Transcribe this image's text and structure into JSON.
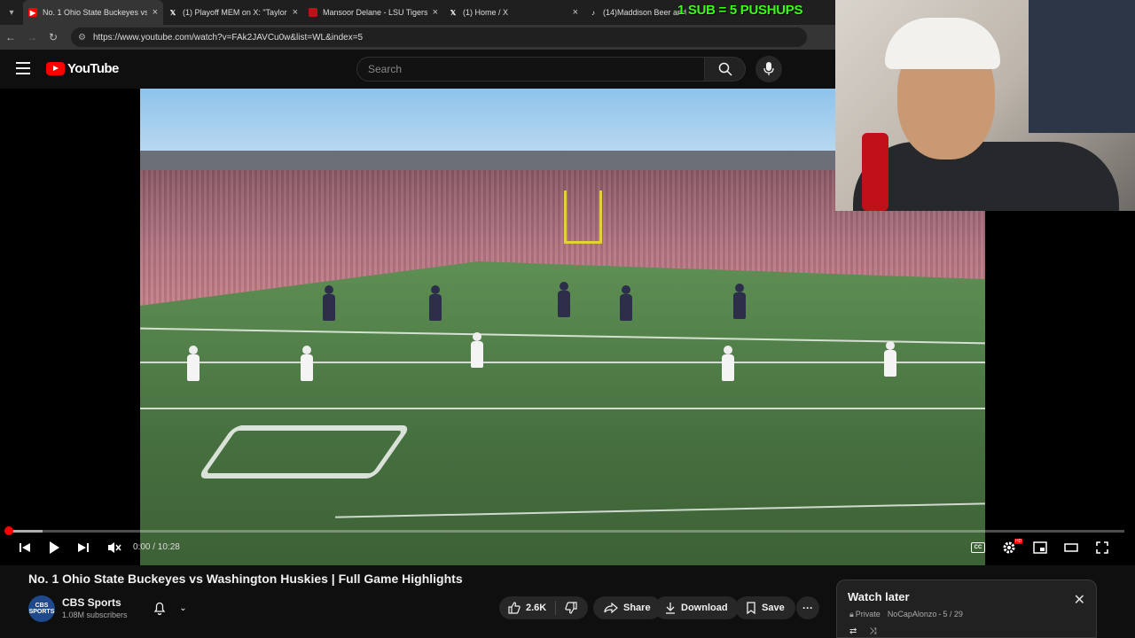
{
  "browser": {
    "tabs": [
      {
        "title": "No. 1 Ohio State Buckeyes vs W",
        "fav": "youtube",
        "fav_color": "#ff0000",
        "active": true
      },
      {
        "title": "(1) Playoff MEM on X: \"Taylor Je",
        "fav": "x",
        "fav_color": "#ffffff",
        "active": false
      },
      {
        "title": "Mansoor Delane - LSU Tigers C",
        "fav": "lsu",
        "fav_color": "#c0101a",
        "active": false
      },
      {
        "title": "(1) Home / X",
        "fav": "x",
        "fav_color": "#ffffff",
        "active": false
      },
      {
        "title": "(14)Maddison Beer and",
        "fav": "tiktok",
        "fav_color": "#ffffff",
        "active": false
      }
    ],
    "url": "https://www.youtube.com/watch?v=FAk2JAVCu0w&list=WL&index=5"
  },
  "stream_overlay": "1 SUB = 5 PUSHUPS",
  "youtube": {
    "logo_text": "YouTube",
    "search_placeholder": "Search"
  },
  "player": {
    "time": "0:00 / 10:28",
    "progress_played": 0.0,
    "progress_buffered": 0.03,
    "hd_badge": "HD",
    "cc_label": "CC"
  },
  "video": {
    "title": "No. 1 Ohio State Buckeyes vs Washington Huskies | Full Game Highlights",
    "channel": "CBS Sports",
    "channel_avatar_text": "CBS SPORTS",
    "subscribers": "1.08M subscribers",
    "likes": "2.6K",
    "share_label": "Share",
    "download_label": "Download",
    "save_label": "Save"
  },
  "watch_later": {
    "title": "Watch later",
    "privacy": "Private",
    "owner": "NoCapAlonzo",
    "position": "5 / 29"
  },
  "colors": {
    "accent": "#ff0000",
    "background": "#0f0f0f",
    "overlay_green": "#39ff14"
  }
}
